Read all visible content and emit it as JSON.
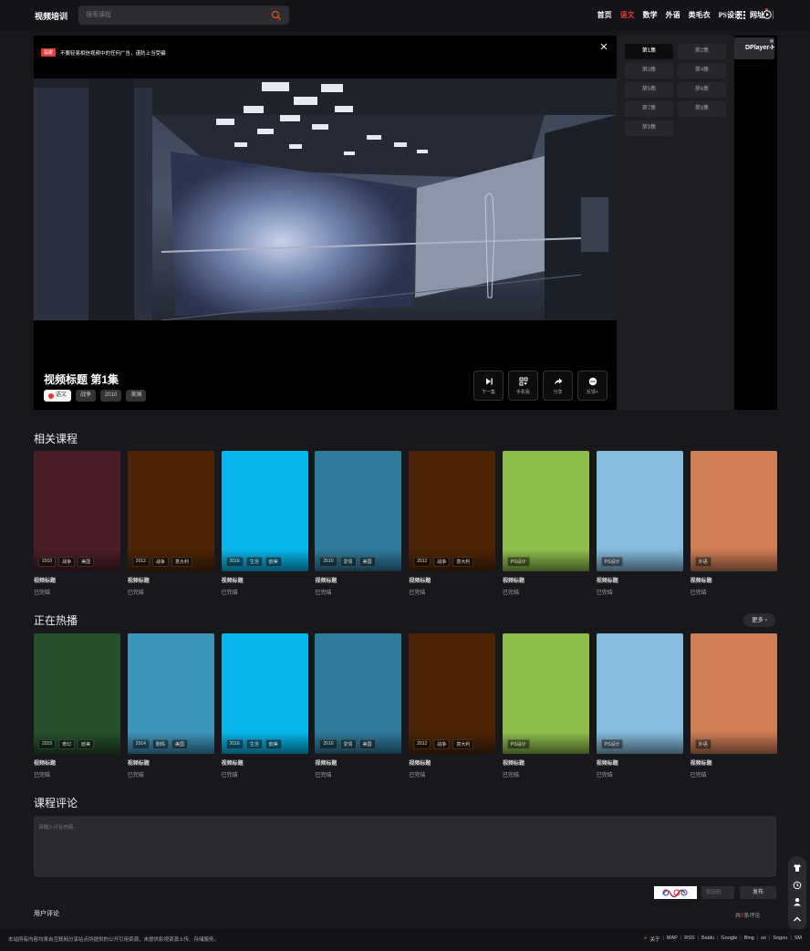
{
  "header": {
    "logo": "视频培训",
    "search_placeholder": "搜索课程",
    "nav": [
      {
        "label": "首页",
        "active": false
      },
      {
        "label": "语文",
        "active": true
      },
      {
        "label": "数学",
        "active": false
      },
      {
        "label": "外语",
        "active": false
      },
      {
        "label": "类毛衣",
        "active": false
      },
      {
        "label": "PS设计",
        "active": false
      },
      {
        "label": "网址",
        "active": false,
        "dot": true
      }
    ]
  },
  "player": {
    "ad_badge": "提醒",
    "ad_text": "不要轻易相信视频中的任何广告，谨防上当受骗",
    "title": "视频标题  第1集",
    "tags": [
      "语文",
      "战争",
      "2010",
      "美国"
    ],
    "controls": [
      {
        "icon": "next-icon",
        "label": "下一集"
      },
      {
        "icon": "qrcode-icon",
        "label": "手机看"
      },
      {
        "icon": "share-icon",
        "label": "分享"
      },
      {
        "icon": "more-icon",
        "label": "反馈+"
      }
    ],
    "dplayer_tab": "DPlayer-H"
  },
  "episodes": [
    "第1集",
    "第2集",
    "第3集",
    "第4集",
    "第5集",
    "第6集",
    "第7集",
    "第8集",
    "第9集"
  ],
  "related": {
    "title": "相关课程",
    "cards": [
      {
        "color": "#4a1d26",
        "tags": [
          "2010",
          "战争",
          "美国"
        ],
        "title": "视频标题",
        "status": "已完结"
      },
      {
        "color": "#4d2406",
        "tags": [
          "2012",
          "战争",
          "意大利"
        ],
        "title": "视频标题",
        "status": "已完结"
      },
      {
        "color": "#06b6ea",
        "tags": [
          "2016",
          "生活",
          "欧美"
        ],
        "title": "视频标题",
        "status": "已完结"
      },
      {
        "color": "#2f7b9c",
        "tags": [
          "2010",
          "爱情",
          "美国"
        ],
        "title": "视频标题",
        "status": "已完结"
      },
      {
        "color": "#4d2406",
        "tags": [
          "2012",
          "战争",
          "意大利"
        ],
        "title": "视频标题",
        "status": "已完结"
      },
      {
        "color": "#8ebd4c",
        "tags": [
          "PS设计"
        ],
        "title": "视频标题",
        "status": "已完结"
      },
      {
        "color": "#85bbdc",
        "tags": [
          "PS设计"
        ],
        "title": "视频标题",
        "status": "已完结"
      },
      {
        "color": "#ce7d55",
        "tags": [
          "外语"
        ],
        "title": "视频标题",
        "status": "已完结"
      }
    ]
  },
  "hot": {
    "title": "正在热播",
    "more": "更多 ›",
    "cards": [
      {
        "color": "#25502b",
        "tags": [
          "2015",
          "奇幻",
          "欧美"
        ],
        "title": "视频标题",
        "status": "已完结"
      },
      {
        "color": "#3e94ba",
        "tags": [
          "2014",
          "剧情",
          "美国"
        ],
        "title": "视频标题",
        "status": "已完结"
      },
      {
        "color": "#06b6ea",
        "tags": [
          "2016",
          "生活",
          "欧美"
        ],
        "title": "视频标题",
        "status": "已完结"
      },
      {
        "color": "#2f7b9c",
        "tags": [
          "2010",
          "爱情",
          "美国"
        ],
        "title": "视频标题",
        "status": "已完结"
      },
      {
        "color": "#4d2406",
        "tags": [
          "2012",
          "战争",
          "意大利"
        ],
        "title": "视频标题",
        "status": "已完结"
      },
      {
        "color": "#8ebd4c",
        "tags": [
          "PS设计"
        ],
        "title": "视频标题",
        "status": "已完结"
      },
      {
        "color": "#85bbdc",
        "tags": [
          "PS设计"
        ],
        "title": "视频标题",
        "status": "已完结"
      },
      {
        "color": "#ce7d55",
        "tags": [
          "外语"
        ],
        "title": "视频标题",
        "status": "已完结"
      }
    ]
  },
  "comments": {
    "title": "课程评论",
    "placeholder": "请输入评论内容...",
    "captcha_placeholder": "验证码",
    "publish": "发布",
    "user_comments": "用户评论",
    "count_prefix": "共",
    "count": "0",
    "count_suffix": "条评论"
  },
  "footer": {
    "text": "本站所有内容均来自互联网分享站点所提供的公开引用资源，未提供影视资源上传、存储服务。",
    "links": [
      "关于",
      "MAP",
      "RSS",
      "Baidu",
      "Google",
      "Bing",
      "so",
      "Sogou",
      "SM"
    ]
  }
}
